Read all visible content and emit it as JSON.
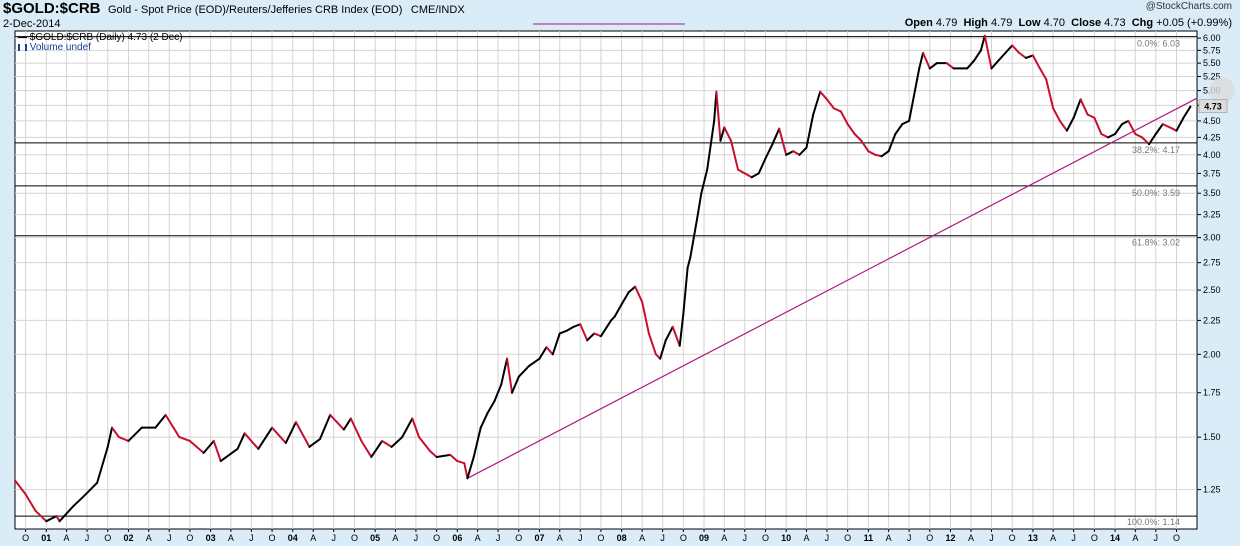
{
  "header": {
    "symbol": "$GOLD:$CRB",
    "description": "Gold - Spot Price (EOD)/Reuters/Jefferies CRB Index (EOD)",
    "exchange": "CME/INDX",
    "date": "2-Dec-2014",
    "watermark": "@StockCharts.com",
    "ohlc": {
      "open_label": "Open",
      "open": "4.79",
      "high_label": "High",
      "high": "4.79",
      "low_label": "Low",
      "low": "4.70",
      "close_label": "Close",
      "close": "4.73",
      "chg_label": "Chg",
      "chg": "+0.05 (+0.99%)"
    }
  },
  "legend": {
    "price_entry": "$GOLD:$CRB (Daily) 4.73 (2 Dec)",
    "volume_entry": "Volume undef"
  },
  "colors": {
    "background": "#d9ecf7",
    "plot_bg": "#ffffff",
    "grid": "#d4d4d4",
    "price_up": "#000000",
    "price_down": "#c8102e",
    "trendline": "#b0187e",
    "fib_line": "#000000",
    "last_price_bg": "#dcdcdc"
  },
  "chart_data": {
    "type": "line",
    "title": "$GOLD:$CRB",
    "scale": "log",
    "ylim": [
      1.09,
      6.15
    ],
    "y_ticks": [
      1.25,
      1.5,
      1.75,
      2.0,
      2.25,
      2.5,
      2.75,
      3.0,
      3.25,
      3.5,
      3.75,
      4.0,
      4.25,
      4.5,
      4.75,
      5.0,
      5.25,
      5.5,
      5.75,
      6.0
    ],
    "y_tick_labels": [
      "1.25",
      "1.50",
      "1.75",
      "2.00",
      "2.25",
      "2.50",
      "2.75",
      "3.00",
      "3.25",
      "3.50",
      "3.75",
      "4.00",
      "4.25",
      "4.50",
      "4.75",
      "5.00",
      "5.25",
      "5.50",
      "5.75",
      "6.00"
    ],
    "xlim": [
      "2000-08-15",
      "2014-12-31"
    ],
    "x_ticks": [
      {
        "date": "2000-10-01",
        "label": "O",
        "year": false
      },
      {
        "date": "2001-01-01",
        "label": "01",
        "year": true
      },
      {
        "date": "2001-04-01",
        "label": "A",
        "year": false
      },
      {
        "date": "2001-07-01",
        "label": "J",
        "year": false
      },
      {
        "date": "2001-10-01",
        "label": "O",
        "year": false
      },
      {
        "date": "2002-01-01",
        "label": "02",
        "year": true
      },
      {
        "date": "2002-04-01",
        "label": "A",
        "year": false
      },
      {
        "date": "2002-07-01",
        "label": "J",
        "year": false
      },
      {
        "date": "2002-10-01",
        "label": "O",
        "year": false
      },
      {
        "date": "2003-01-01",
        "label": "03",
        "year": true
      },
      {
        "date": "2003-04-01",
        "label": "A",
        "year": false
      },
      {
        "date": "2003-07-01",
        "label": "J",
        "year": false
      },
      {
        "date": "2003-10-01",
        "label": "O",
        "year": false
      },
      {
        "date": "2004-01-01",
        "label": "04",
        "year": true
      },
      {
        "date": "2004-04-01",
        "label": "A",
        "year": false
      },
      {
        "date": "2004-07-01",
        "label": "J",
        "year": false
      },
      {
        "date": "2004-10-01",
        "label": "O",
        "year": false
      },
      {
        "date": "2005-01-01",
        "label": "05",
        "year": true
      },
      {
        "date": "2005-04-01",
        "label": "A",
        "year": false
      },
      {
        "date": "2005-07-01",
        "label": "J",
        "year": false
      },
      {
        "date": "2005-10-01",
        "label": "O",
        "year": false
      },
      {
        "date": "2006-01-01",
        "label": "06",
        "year": true
      },
      {
        "date": "2006-04-01",
        "label": "A",
        "year": false
      },
      {
        "date": "2006-07-01",
        "label": "J",
        "year": false
      },
      {
        "date": "2006-10-01",
        "label": "O",
        "year": false
      },
      {
        "date": "2007-01-01",
        "label": "07",
        "year": true
      },
      {
        "date": "2007-04-01",
        "label": "A",
        "year": false
      },
      {
        "date": "2007-07-01",
        "label": "J",
        "year": false
      },
      {
        "date": "2007-10-01",
        "label": "O",
        "year": false
      },
      {
        "date": "2008-01-01",
        "label": "08",
        "year": true
      },
      {
        "date": "2008-04-01",
        "label": "A",
        "year": false
      },
      {
        "date": "2008-07-01",
        "label": "J",
        "year": false
      },
      {
        "date": "2008-10-01",
        "label": "O",
        "year": false
      },
      {
        "date": "2009-01-01",
        "label": "09",
        "year": true
      },
      {
        "date": "2009-04-01",
        "label": "A",
        "year": false
      },
      {
        "date": "2009-07-01",
        "label": "J",
        "year": false
      },
      {
        "date": "2009-10-01",
        "label": "O",
        "year": false
      },
      {
        "date": "2010-01-01",
        "label": "10",
        "year": true
      },
      {
        "date": "2010-04-01",
        "label": "A",
        "year": false
      },
      {
        "date": "2010-07-01",
        "label": "J",
        "year": false
      },
      {
        "date": "2010-10-01",
        "label": "O",
        "year": false
      },
      {
        "date": "2011-01-01",
        "label": "11",
        "year": true
      },
      {
        "date": "2011-04-01",
        "label": "A",
        "year": false
      },
      {
        "date": "2011-07-01",
        "label": "J",
        "year": false
      },
      {
        "date": "2011-10-01",
        "label": "O",
        "year": false
      },
      {
        "date": "2012-01-01",
        "label": "12",
        "year": true
      },
      {
        "date": "2012-04-01",
        "label": "A",
        "year": false
      },
      {
        "date": "2012-07-01",
        "label": "J",
        "year": false
      },
      {
        "date": "2012-10-01",
        "label": "O",
        "year": false
      },
      {
        "date": "2013-01-01",
        "label": "13",
        "year": true
      },
      {
        "date": "2013-04-01",
        "label": "A",
        "year": false
      },
      {
        "date": "2013-07-01",
        "label": "J",
        "year": false
      },
      {
        "date": "2013-10-01",
        "label": "O",
        "year": false
      },
      {
        "date": "2014-01-01",
        "label": "14",
        "year": true
      },
      {
        "date": "2014-04-01",
        "label": "A",
        "year": false
      },
      {
        "date": "2014-07-01",
        "label": "J",
        "year": false
      },
      {
        "date": "2014-10-01",
        "label": "O",
        "year": false
      }
    ],
    "series": [
      {
        "values": [
          [
            "2000-08-15",
            1.29
          ],
          [
            "2000-10-01",
            1.23
          ],
          [
            "2000-11-15",
            1.16
          ],
          [
            "2001-01-01",
            1.12
          ],
          [
            "2001-02-15",
            1.14
          ],
          [
            "2001-03-01",
            1.12
          ],
          [
            "2001-05-01",
            1.18
          ],
          [
            "2001-06-15",
            1.22
          ],
          [
            "2001-08-15",
            1.28
          ],
          [
            "2001-10-01",
            1.45
          ],
          [
            "2001-10-20",
            1.55
          ],
          [
            "2001-11-20",
            1.5
          ],
          [
            "2002-01-01",
            1.48
          ],
          [
            "2002-03-01",
            1.55
          ],
          [
            "2002-05-01",
            1.55
          ],
          [
            "2002-06-15",
            1.62
          ],
          [
            "2002-08-15",
            1.5
          ],
          [
            "2002-10-01",
            1.48
          ],
          [
            "2002-12-01",
            1.42
          ],
          [
            "2003-01-15",
            1.48
          ],
          [
            "2003-02-15",
            1.38
          ],
          [
            "2003-05-01",
            1.44
          ],
          [
            "2003-06-01",
            1.52
          ],
          [
            "2003-08-01",
            1.44
          ],
          [
            "2003-10-01",
            1.55
          ],
          [
            "2003-12-01",
            1.47
          ],
          [
            "2004-01-15",
            1.58
          ],
          [
            "2004-03-15",
            1.45
          ],
          [
            "2004-05-01",
            1.49
          ],
          [
            "2004-06-15",
            1.62
          ],
          [
            "2004-08-15",
            1.54
          ],
          [
            "2004-09-15",
            1.6
          ],
          [
            "2004-11-01",
            1.48
          ],
          [
            "2004-12-15",
            1.4
          ],
          [
            "2005-02-01",
            1.48
          ],
          [
            "2005-03-15",
            1.45
          ],
          [
            "2005-05-01",
            1.5
          ],
          [
            "2005-06-15",
            1.6
          ],
          [
            "2005-07-15",
            1.5
          ],
          [
            "2005-09-01",
            1.43
          ],
          [
            "2005-10-01",
            1.4
          ],
          [
            "2005-12-01",
            1.41
          ],
          [
            "2006-01-01",
            1.38
          ],
          [
            "2006-02-01",
            1.37
          ],
          [
            "2006-02-15",
            1.3
          ],
          [
            "2006-03-15",
            1.4
          ],
          [
            "2006-04-15",
            1.55
          ],
          [
            "2006-05-15",
            1.63
          ],
          [
            "2006-06-15",
            1.7
          ],
          [
            "2006-07-15",
            1.8
          ],
          [
            "2006-08-10",
            1.97
          ],
          [
            "2006-09-01",
            1.75
          ],
          [
            "2006-10-01",
            1.85
          ],
          [
            "2006-11-15",
            1.92
          ],
          [
            "2007-01-01",
            1.97
          ],
          [
            "2007-02-01",
            2.05
          ],
          [
            "2007-03-01",
            2.0
          ],
          [
            "2007-04-01",
            2.15
          ],
          [
            "2007-05-01",
            2.17
          ],
          [
            "2007-06-01",
            2.2
          ],
          [
            "2007-07-01",
            2.22
          ],
          [
            "2007-08-01",
            2.1
          ],
          [
            "2007-09-01",
            2.15
          ],
          [
            "2007-10-01",
            2.13
          ],
          [
            "2007-11-15",
            2.25
          ],
          [
            "2007-12-01",
            2.28
          ],
          [
            "2008-01-01",
            2.38
          ],
          [
            "2008-02-01",
            2.48
          ],
          [
            "2008-03-01",
            2.53
          ],
          [
            "2008-04-01",
            2.4
          ],
          [
            "2008-05-01",
            2.15
          ],
          [
            "2008-06-01",
            2.0
          ],
          [
            "2008-06-20",
            1.97
          ],
          [
            "2008-07-15",
            2.1
          ],
          [
            "2008-08-15",
            2.2
          ],
          [
            "2008-09-15",
            2.06
          ],
          [
            "2008-10-01",
            2.3
          ],
          [
            "2008-10-20",
            2.7
          ],
          [
            "2008-11-01",
            2.8
          ],
          [
            "2008-12-01",
            3.2
          ],
          [
            "2008-12-20",
            3.5
          ],
          [
            "2009-01-15",
            3.8
          ],
          [
            "2009-02-15",
            4.5
          ],
          [
            "2009-02-25",
            4.98
          ],
          [
            "2009-03-15",
            4.2
          ],
          [
            "2009-04-01",
            4.4
          ],
          [
            "2009-05-01",
            4.2
          ],
          [
            "2009-06-01",
            3.8
          ],
          [
            "2009-07-01",
            3.75
          ],
          [
            "2009-08-01",
            3.7
          ],
          [
            "2009-09-01",
            3.75
          ],
          [
            "2009-10-01",
            3.95
          ],
          [
            "2009-11-01",
            4.15
          ],
          [
            "2009-12-01",
            4.38
          ],
          [
            "2010-01-01",
            4.0
          ],
          [
            "2010-02-01",
            4.05
          ],
          [
            "2010-03-01",
            4.0
          ],
          [
            "2010-04-01",
            4.1
          ],
          [
            "2010-05-01",
            4.6
          ],
          [
            "2010-06-01",
            4.98
          ],
          [
            "2010-07-01",
            4.85
          ],
          [
            "2010-08-01",
            4.7
          ],
          [
            "2010-09-01",
            4.65
          ],
          [
            "2010-10-01",
            4.45
          ],
          [
            "2010-11-01",
            4.3
          ],
          [
            "2010-12-01",
            4.2
          ],
          [
            "2011-01-01",
            4.05
          ],
          [
            "2011-02-01",
            4.0
          ],
          [
            "2011-03-01",
            3.98
          ],
          [
            "2011-04-01",
            4.05
          ],
          [
            "2011-05-01",
            4.3
          ],
          [
            "2011-06-01",
            4.45
          ],
          [
            "2011-07-01",
            4.5
          ],
          [
            "2011-08-15",
            5.4
          ],
          [
            "2011-09-01",
            5.7
          ],
          [
            "2011-10-01",
            5.4
          ],
          [
            "2011-11-01",
            5.5
          ],
          [
            "2011-12-15",
            5.5
          ],
          [
            "2012-01-15",
            5.4
          ],
          [
            "2012-02-15",
            5.4
          ],
          [
            "2012-03-15",
            5.4
          ],
          [
            "2012-04-15",
            5.55
          ],
          [
            "2012-05-15",
            5.75
          ],
          [
            "2012-06-01",
            6.05
          ],
          [
            "2012-07-01",
            5.4
          ],
          [
            "2012-08-01",
            5.55
          ],
          [
            "2012-09-01",
            5.7
          ],
          [
            "2012-10-01",
            5.85
          ],
          [
            "2012-11-01",
            5.7
          ],
          [
            "2012-12-01",
            5.6
          ],
          [
            "2013-01-01",
            5.65
          ],
          [
            "2013-02-01",
            5.4
          ],
          [
            "2013-03-01",
            5.2
          ],
          [
            "2013-04-01",
            4.7
          ],
          [
            "2013-05-01",
            4.5
          ],
          [
            "2013-06-01",
            4.35
          ],
          [
            "2013-07-01",
            4.55
          ],
          [
            "2013-08-01",
            4.85
          ],
          [
            "2013-09-01",
            4.6
          ],
          [
            "2013-10-01",
            4.55
          ],
          [
            "2013-11-01",
            4.3
          ],
          [
            "2013-12-01",
            4.25
          ],
          [
            "2014-01-01",
            4.3
          ],
          [
            "2014-02-01",
            4.45
          ],
          [
            "2014-03-01",
            4.5
          ],
          [
            "2014-04-01",
            4.3
          ],
          [
            "2014-05-01",
            4.25
          ],
          [
            "2014-06-01",
            4.15
          ],
          [
            "2014-07-01",
            4.3
          ],
          [
            "2014-08-01",
            4.45
          ],
          [
            "2014-09-01",
            4.4
          ],
          [
            "2014-10-01",
            4.35
          ],
          [
            "2014-11-01",
            4.55
          ],
          [
            "2014-12-02",
            4.73
          ]
        ]
      }
    ],
    "trendline": {
      "start": [
        "2006-02-15",
        1.3
      ],
      "end": [
        "2014-12-31",
        4.87
      ]
    },
    "fib_levels": [
      {
        "label": "0.0%: 6.03",
        "value": 6.03
      },
      {
        "label": "38.2%: 4.17",
        "value": 4.17
      },
      {
        "label": "50.0%: 3.59",
        "value": 3.59
      },
      {
        "label": "61.8%: 3.02",
        "value": 3.02
      },
      {
        "label": "100.0%: 1.14",
        "value": 1.14
      }
    ],
    "last_value_label": "4.73",
    "last_value": 4.73
  }
}
